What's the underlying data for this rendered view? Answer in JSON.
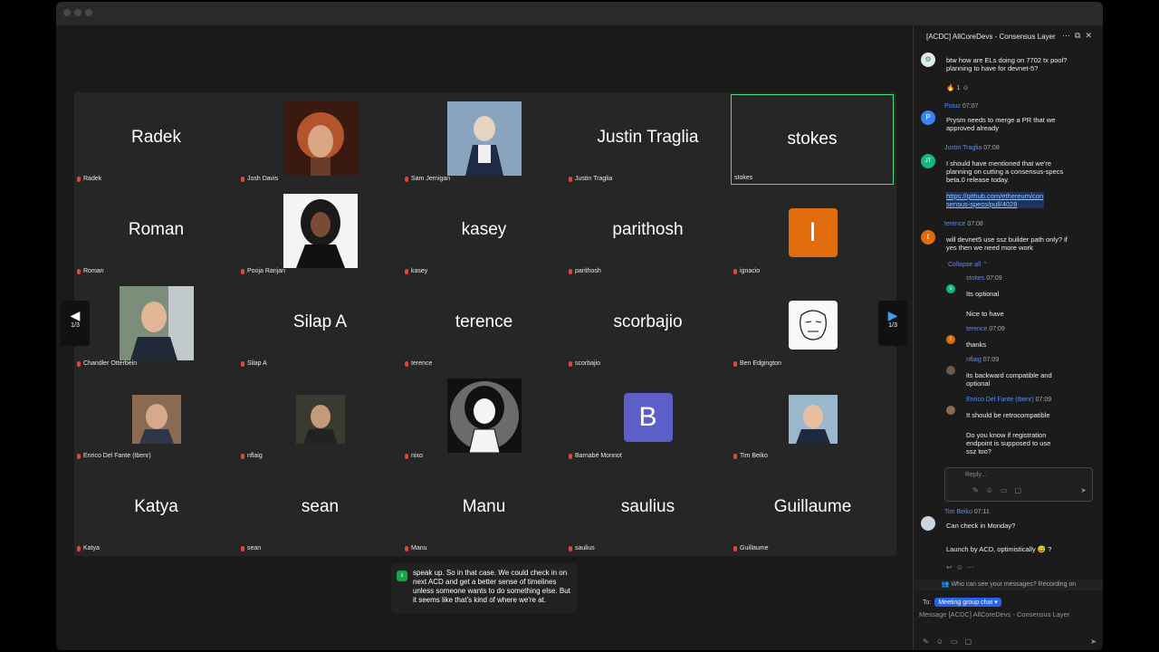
{
  "chat": {
    "title": "[ACDC] AllCoreDevs - Consensus Layer",
    "messages": [
      {
        "text": "btw how are ELs doing on 7702 tx pool? planning to have for devnet-5?",
        "reaction": "🔥 1"
      },
      {
        "sender": "Potuz",
        "time": "07:07",
        "text": "Prysm needs to merge a PR that we approved already"
      },
      {
        "sender": "Justin Traglia",
        "time": "07:08",
        "text": "I should have mentioned that we're planning on cutting a consensus-specs beta.0 release today.",
        "link": "https://github.com/ethereum/consensus-specs/pull/4028"
      },
      {
        "sender": "terence",
        "time": "07:08",
        "text": "will devnet5 use ssz builder path only? if yes then we need more work"
      }
    ],
    "collapse_label": "Collapse all",
    "thread": [
      {
        "sender": "stokes",
        "time": "07:09",
        "lines": [
          "Its optional",
          "Nice to have"
        ]
      },
      {
        "sender": "terence",
        "time": "07:09",
        "lines": [
          "thanks"
        ]
      },
      {
        "sender": "nflaig",
        "time": "07:09",
        "lines": [
          "its backward compatible and optional"
        ]
      },
      {
        "sender": "Enrico Del Fante (tbenr)",
        "time": "07:09",
        "lines": [
          "It should be retrocompatible",
          "Do you know if registration endpoint is supposed to use ssz too?"
        ]
      }
    ],
    "reply_placeholder": "Reply...",
    "last": {
      "sender": "Tim Beiko",
      "time": "07:11",
      "lines": [
        "Can check in Monday?",
        "Launch by ACD, optimistically 😅 ?"
      ]
    },
    "notice": "Who can see your messages? Recording on",
    "to_label": "To:",
    "to_value": "Meeting group chat",
    "compose_placeholder": "Message [ACDC] AllCoreDevs - Consensus Layer"
  },
  "pager": {
    "left": "1/3",
    "right": "1/3"
  },
  "caption": {
    "avatar": "s",
    "text": "speak up. So in that case. We could check in on next ACD and get a better sense of timelines unless someone wants to do something else. But it seems like that's kind of where we're at."
  },
  "tiles": [
    {
      "big": "Radek",
      "label": "Radek"
    },
    {
      "label": "Josh Davis"
    },
    {
      "label": "Sam Jernigan"
    },
    {
      "big": "Justin Traglia",
      "label": "Justin Traglia"
    },
    {
      "big": "stokes",
      "label": "stokes"
    },
    {
      "big": "Roman",
      "label": "Roman"
    },
    {
      "label": "Pooja Ranjan"
    },
    {
      "big": "kasey",
      "label": "kasey"
    },
    {
      "big": "parithosh",
      "label": "parithosh"
    },
    {
      "letter": "I",
      "label": "ignacio"
    },
    {
      "label": "Chandler Otterbein"
    },
    {
      "big": "Silap A",
      "label": "Silap A"
    },
    {
      "big": "terence",
      "label": "terence"
    },
    {
      "big": "scorbajio",
      "label": "scorbajio"
    },
    {
      "label": "Ben Edgington"
    },
    {
      "label": "Enrico Del Fante (tbenr)"
    },
    {
      "label": "nflaig"
    },
    {
      "label": "nixo"
    },
    {
      "letter": "B",
      "label": "Barnabé Monnot"
    },
    {
      "label": "Tim Beiko"
    },
    {
      "big": "Katya",
      "label": "Katya"
    },
    {
      "big": "sean",
      "label": "sean"
    },
    {
      "big": "Manu",
      "label": "Manu"
    },
    {
      "big": "saulius",
      "label": "saulius"
    },
    {
      "big": "Guillaume",
      "label": "Guillaume"
    }
  ],
  "colors": {
    "active_speaker": "#4ade80",
    "ignacio": "#e06c0b",
    "barnabe": "#5b5fc7"
  }
}
